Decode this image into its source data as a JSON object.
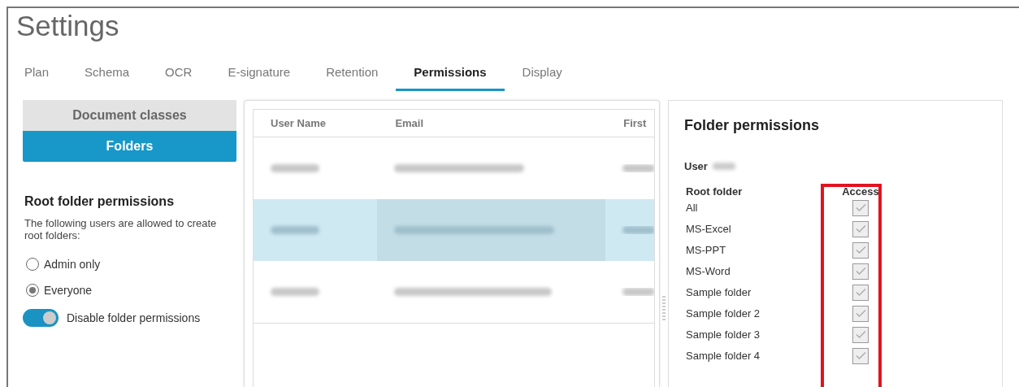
{
  "title": "Settings",
  "tabs": [
    {
      "label": "Plan",
      "selected": false
    },
    {
      "label": "Schema",
      "selected": false
    },
    {
      "label": "OCR",
      "selected": false
    },
    {
      "label": "E-signature",
      "selected": false
    },
    {
      "label": "Retention",
      "selected": false
    },
    {
      "label": "Permissions",
      "selected": true
    },
    {
      "label": "Display",
      "selected": false
    }
  ],
  "sections": [
    {
      "label": "Document classes",
      "selected": false
    },
    {
      "label": "Folders",
      "selected": true
    }
  ],
  "root_permissions": {
    "heading": "Root folder permissions",
    "description": "The following users are allowed to create root folders:",
    "options": [
      {
        "label": "Admin only",
        "selected": false
      },
      {
        "label": "Everyone",
        "selected": true
      }
    ],
    "toggle": {
      "label": "Disable folder permissions",
      "on": true
    }
  },
  "table": {
    "columns": [
      "User Name",
      "Email",
      "First"
    ],
    "rows": [
      {
        "selected": false
      },
      {
        "selected": true
      },
      {
        "selected": false
      }
    ]
  },
  "folder_permissions": {
    "heading": "Folder permissions",
    "user_label": "User",
    "folder_column": "Root folder",
    "access_column": "Access",
    "access_highlighted": true,
    "folders": [
      {
        "name": "All",
        "checked": true,
        "disabled": true
      },
      {
        "name": "MS-Excel",
        "checked": true,
        "disabled": true
      },
      {
        "name": "MS-PPT",
        "checked": true,
        "disabled": true
      },
      {
        "name": "MS-Word",
        "checked": true,
        "disabled": true
      },
      {
        "name": "Sample folder",
        "checked": true,
        "disabled": true
      },
      {
        "name": "Sample folder 2",
        "checked": true,
        "disabled": true
      },
      {
        "name": "Sample folder 3",
        "checked": true,
        "disabled": true
      },
      {
        "name": "Sample folder 4",
        "checked": true,
        "disabled": true
      }
    ]
  }
}
